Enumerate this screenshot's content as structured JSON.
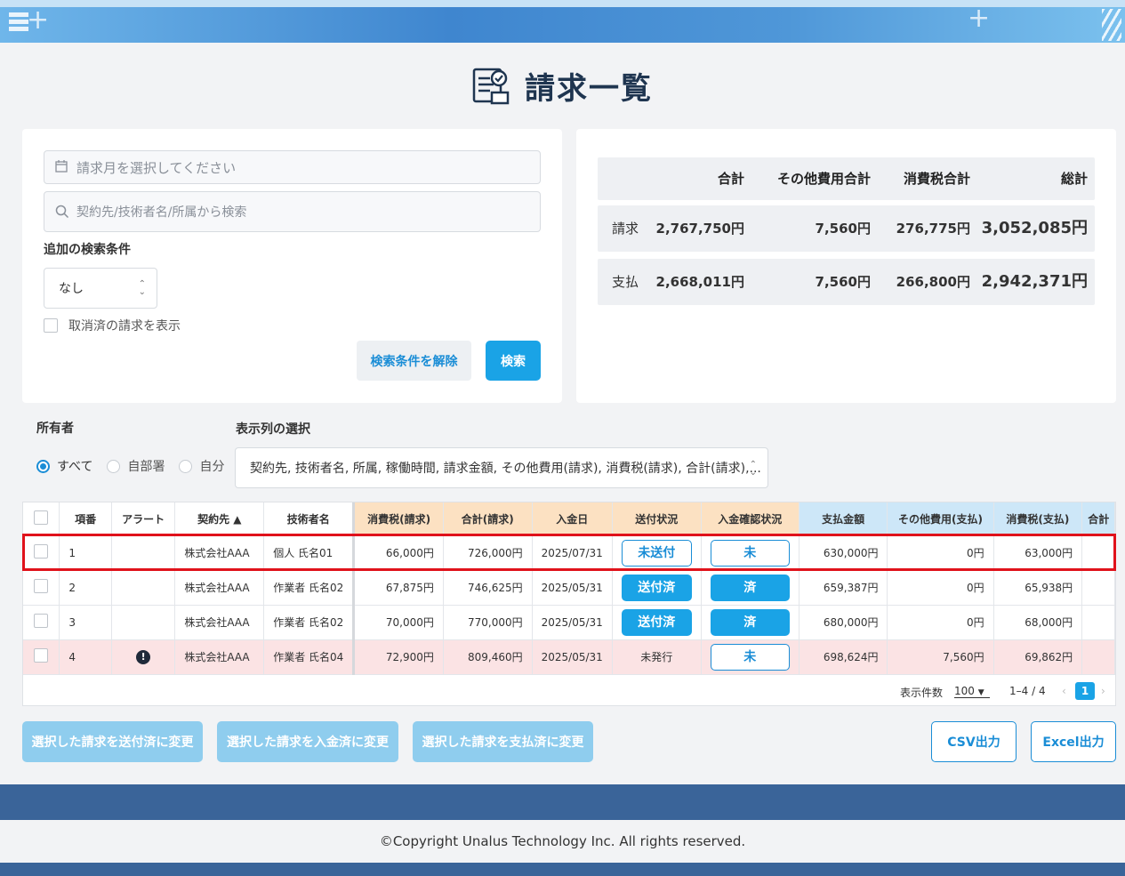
{
  "page": {
    "title": "請求一覧"
  },
  "search": {
    "month_placeholder": "請求月を選択してください",
    "keyword_placeholder": "契約先/技術者名/所属から検索",
    "extra_label": "追加の検索条件",
    "extra_value": "なし",
    "show_cancelled_label": "取消済の請求を表示",
    "clear_label": "検索条件を解除",
    "search_label": "検索"
  },
  "summary": {
    "headers": [
      "合計",
      "その他費用合計",
      "消費税合計",
      "総計"
    ],
    "rows": [
      {
        "label": "請求",
        "total": "2,767,750円",
        "other": "7,560円",
        "tax": "276,775円",
        "grand": "3,052,085円"
      },
      {
        "label": "支払",
        "total": "2,668,011円",
        "other": "7,560円",
        "tax": "266,800円",
        "grand": "2,942,371円"
      }
    ]
  },
  "owner": {
    "label": "所有者",
    "options": [
      "すべて",
      "自部署",
      "自分"
    ],
    "selected": "すべて"
  },
  "columns_select": {
    "label": "表示列の選択",
    "value": "契約先, 技術者名, 所属, 稼働時間, 請求金額, その他費用(請求), 消費税(請求), 合計(請求),..."
  },
  "table": {
    "headers": [
      "項番",
      "アラート",
      "契約先 ▲",
      "技術者名",
      "消費税(請求)",
      "合計(請求)",
      "入金日",
      "送付状況",
      "入金確認状況",
      "支払金額",
      "その他費用(支払)",
      "消費税(支払)",
      "合計"
    ],
    "rows": [
      {
        "no": "1",
        "alert": "",
        "client": "株式会社AAA",
        "engineer": "個人 氏名01",
        "tax_req": "66,000円",
        "total_req": "726,000円",
        "pay_date": "2025/07/31",
        "send": "未送付",
        "send_style": "out",
        "paid": "未",
        "paid_style": "out",
        "pay_amount": "630,000円",
        "other_pay": "0円",
        "tax_pay": "63,000円"
      },
      {
        "no": "2",
        "alert": "",
        "client": "株式会社AAA",
        "engineer": "作業者 氏名02",
        "tax_req": "67,875円",
        "total_req": "746,625円",
        "pay_date": "2025/05/31",
        "send": "送付済",
        "send_style": "fill",
        "paid": "済",
        "paid_style": "fill",
        "pay_amount": "659,387円",
        "other_pay": "0円",
        "tax_pay": "65,938円"
      },
      {
        "no": "3",
        "alert": "",
        "client": "株式会社AAA",
        "engineer": "作業者 氏名02",
        "tax_req": "70,000円",
        "total_req": "770,000円",
        "pay_date": "2025/05/31",
        "send": "送付済",
        "send_style": "fill",
        "paid": "済",
        "paid_style": "fill",
        "pay_amount": "680,000円",
        "other_pay": "0円",
        "tax_pay": "68,000円"
      },
      {
        "no": "4",
        "alert": "!",
        "client": "株式会社AAA",
        "engineer": "作業者 氏名04",
        "tax_req": "72,900円",
        "total_req": "809,460円",
        "pay_date": "2025/05/31",
        "send": "未発行",
        "send_style": "text",
        "paid": "未",
        "paid_style": "out",
        "pay_amount": "698,624円",
        "other_pay": "7,560円",
        "tax_pay": "69,862円"
      }
    ]
  },
  "pager": {
    "per_page_label": "表示件数",
    "per_page": "100",
    "range": "1–4 / 4",
    "current": "1"
  },
  "actions": {
    "mark_sent": "選択した請求を送付済に変更",
    "mark_received": "選択した請求を入金済に変更",
    "mark_paid": "選択した請求を支払済に変更",
    "csv": "CSV出力",
    "excel": "Excel出力"
  },
  "footer": {
    "copyright": "©Copyright Unalus Technology Inc. All rights reserved."
  },
  "colors": {
    "accent": "#1aa3e6",
    "highlight": "#e0121b",
    "header_band": "#3a6499",
    "alert_row": "#fbe3e4"
  }
}
